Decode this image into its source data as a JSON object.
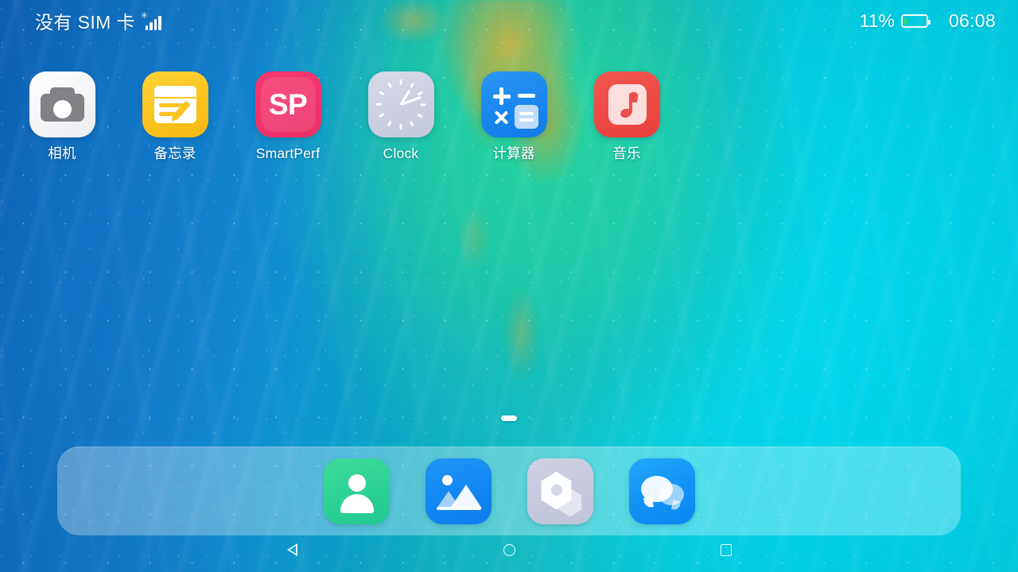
{
  "status_bar": {
    "carrier": "没有 SIM 卡",
    "signal_icon": "signal-bars-icon",
    "signal_bars": 4,
    "battery_percent_label": "11%",
    "battery_level": 11,
    "battery_fill_color": "#3ddc56",
    "battery_icon": "battery-icon",
    "clock": "06:08"
  },
  "home_screen": {
    "apps": [
      {
        "label": "相机",
        "icon": "camera-icon",
        "bg_color": "#f4f5f7"
      },
      {
        "label": "备忘录",
        "icon": "notes-icon",
        "bg_color": "#fcc51f"
      },
      {
        "label": "SmartPerf",
        "icon": "smartperf-icon",
        "bg_color": "#f2356d",
        "glyph": "SP"
      },
      {
        "label": "Clock",
        "icon": "clock-icon",
        "bg_color": "#ccd0e0"
      },
      {
        "label": "计算器",
        "icon": "calculator-icon",
        "bg_color": "#1b88ef"
      },
      {
        "label": "音乐",
        "icon": "music-icon",
        "bg_color": "#ef4a45"
      }
    ],
    "page_indicator": {
      "total_pages": 1,
      "current_page": 1
    }
  },
  "dock": {
    "items": [
      {
        "name": "contacts",
        "icon": "contacts-icon",
        "bg_color": "#2fd295"
      },
      {
        "name": "gallery",
        "icon": "gallery-icon",
        "bg_color": "#1389f2"
      },
      {
        "name": "settings",
        "icon": "settings-icon",
        "bg_color": "#c7cade"
      },
      {
        "name": "messages",
        "icon": "messages-icon",
        "bg_color": "#1394f6"
      }
    ]
  },
  "navigation_bar": {
    "back_icon": "back-triangle-icon",
    "home_icon": "home-circle-icon",
    "recents_icon": "recents-square-icon"
  },
  "wallpaper": {
    "name": "ocean-gradient-wallpaper",
    "colors": [
      "#0f63ba",
      "#1184cd",
      "#14c0c4",
      "#00dcf1",
      "#28d696",
      "#d6b23a"
    ]
  }
}
